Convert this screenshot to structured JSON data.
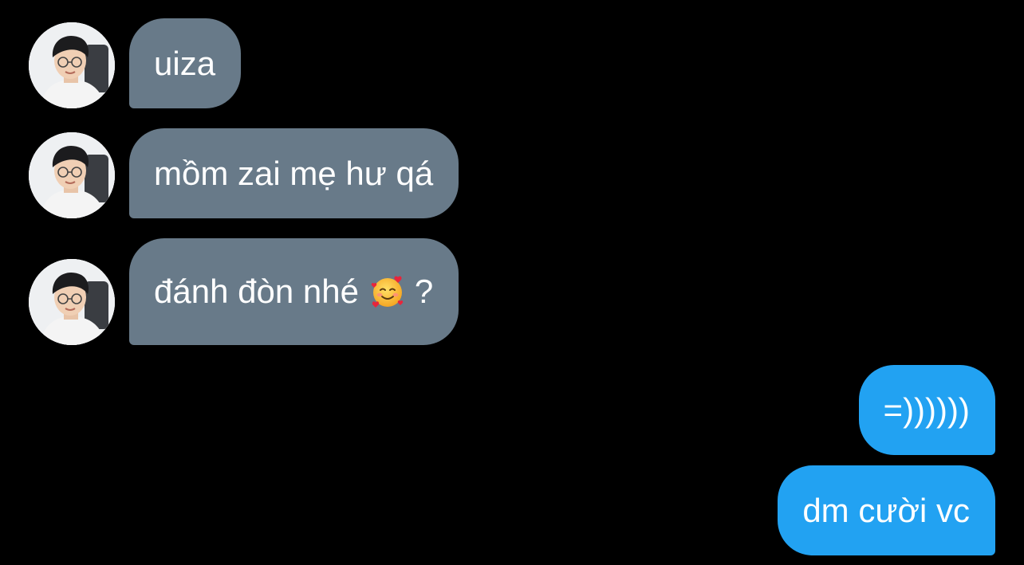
{
  "colors": {
    "background": "#000000",
    "incoming_bubble": "#687a89",
    "outgoing_bubble": "#22a2f2",
    "text": "#ffffff"
  },
  "messages": [
    {
      "direction": "incoming",
      "avatar": "contact-avatar-photo",
      "text": "uiza"
    },
    {
      "direction": "incoming",
      "avatar": "contact-avatar-photo",
      "text": "mồm zai mẹ hư qá"
    },
    {
      "direction": "incoming",
      "avatar": "contact-avatar-photo",
      "text_before_emoji": "đánh đòn nhé",
      "emoji": "smiling-face-with-hearts-emoji",
      "text_after_emoji": "?"
    },
    {
      "direction": "outgoing",
      "text": "=))))))"
    },
    {
      "direction": "outgoing",
      "text": "dm cười vc"
    }
  ]
}
